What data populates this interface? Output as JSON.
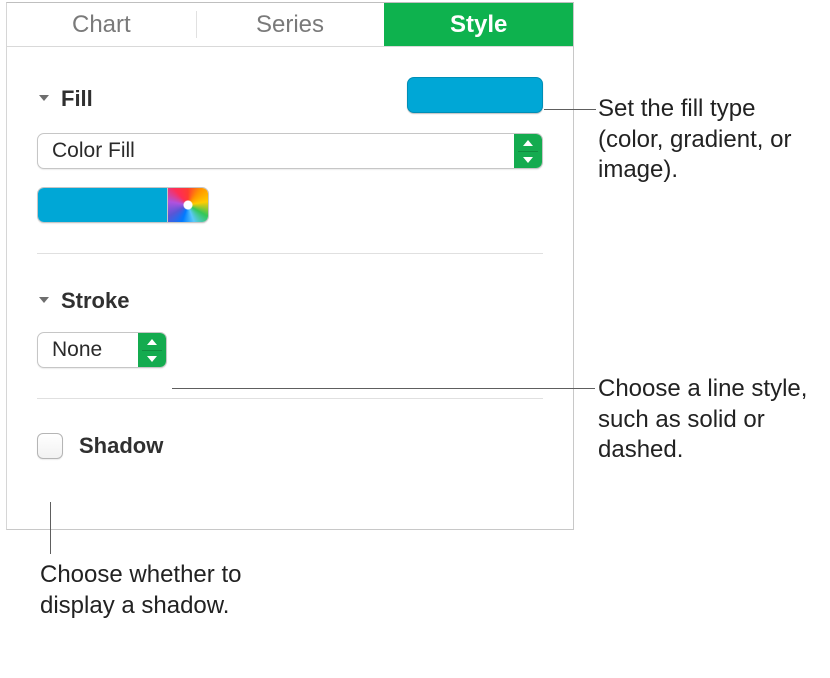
{
  "tabs": {
    "chart": "Chart",
    "series": "Series",
    "style": "Style"
  },
  "fill": {
    "label": "Fill",
    "swatch_color": "#00a7d6",
    "popup_value": "Color Fill",
    "well_color": "#00a7d6"
  },
  "stroke": {
    "label": "Stroke",
    "popup_value": "None"
  },
  "shadow": {
    "label": "Shadow",
    "checked": false
  },
  "callouts": {
    "fill": "Set the fill type (color, gradient, or image).",
    "stroke": "Choose a line style, such as solid or dashed.",
    "shadow": "Choose whether to display a shadow."
  }
}
